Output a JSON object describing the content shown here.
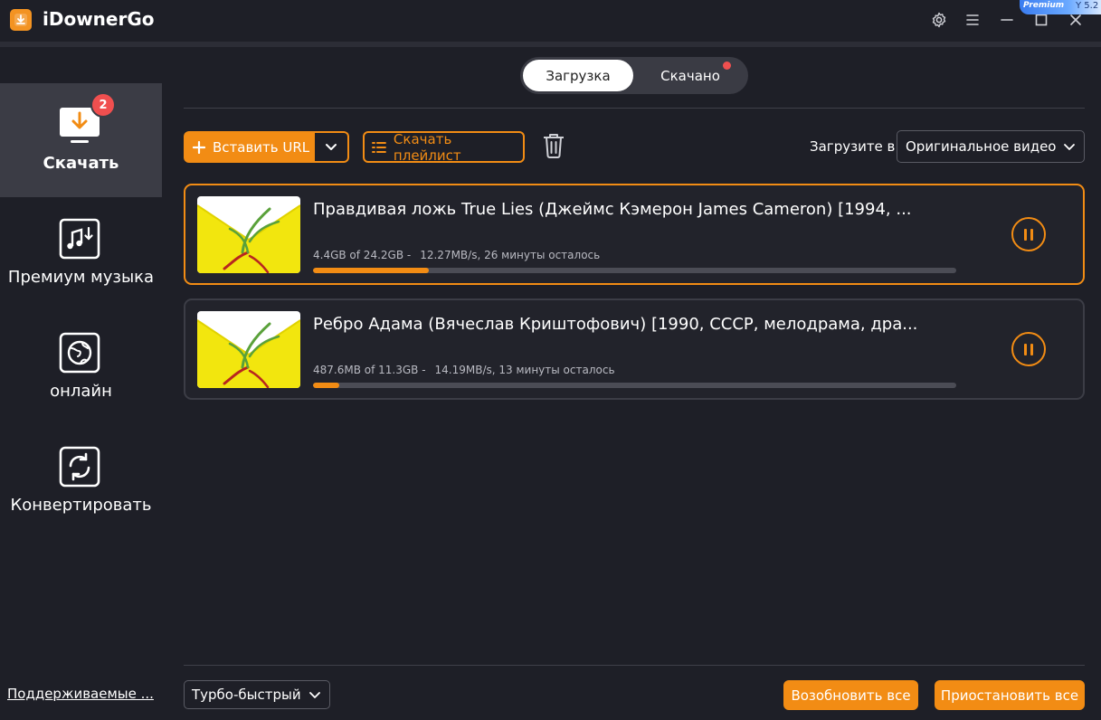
{
  "app": {
    "title": "iDownerGo",
    "premium": "Premium",
    "premium_extra": "Y 5.2"
  },
  "colors": {
    "accent": "#f28c14",
    "badge": "#f04f4f",
    "background": "#1e1f27",
    "active_nav": "#3b3c45"
  },
  "sidebar": {
    "items": [
      {
        "label": "Скачать",
        "icon": "download-monitor-icon",
        "badge": "2",
        "active": true
      },
      {
        "label": "Премиум музыка",
        "icon": "music-download-icon"
      },
      {
        "label": "онлайн",
        "icon": "globe-icon"
      },
      {
        "label": "Конвертировать",
        "icon": "convert-icon"
      }
    ],
    "support_link": "Поддерживаемые ..."
  },
  "tabs": {
    "downloading": "Загрузка",
    "downloaded": "Скачано"
  },
  "toolbar": {
    "paste_url": "Вставить URL",
    "download_playlist": "Скачать плейлист",
    "download_to_label": "Загрузите в",
    "format_selected": "Оригинальное видео"
  },
  "downloads": [
    {
      "title": "Правдивая ложь True Lies (Джеймс Кэмерон James Cameron) [1994, ...",
      "size": "4.4GB of 24.2GB -",
      "speed": "12.27MB/s, 26 минуты осталось",
      "progress": 0.18
    },
    {
      "title": "Ребро Адама (Вячеслав Криштофович) [1990, СССР, мелодрама, дра...",
      "size": "487.6MB of 11.3GB -",
      "speed": "14.19MB/s, 13 минуты осталось",
      "progress": 0.041
    }
  ],
  "footer": {
    "speed_mode": "Турбо-быстрый",
    "resume_all": "Возобновить все",
    "pause_all": "Приостановить все"
  }
}
